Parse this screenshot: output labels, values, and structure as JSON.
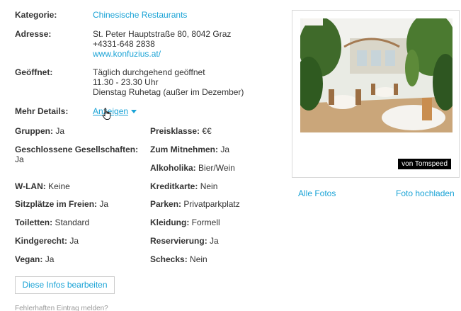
{
  "info": {
    "kategorie": {
      "label": "Kategorie:",
      "value": "Chinesische Restaurants"
    },
    "adresse": {
      "label": "Adresse:",
      "street": "St. Peter Hauptstraße 80, 8042 Graz",
      "phone": "+4331-648 2838",
      "website": "www.konfuzius.at/"
    },
    "geoeffnet": {
      "label": "Geöffnet:",
      "line1": "Täglich durchgehend geöffnet",
      "line2": "11.30 - 23.30 Uhr",
      "line3": "Dienstag Ruhetag (außer im Dezember)"
    },
    "mehr": {
      "label": "Mehr Details:",
      "link": "Anzeigen"
    }
  },
  "features": {
    "gruppen": {
      "label": "Gruppen:",
      "value": "Ja"
    },
    "preisklasse": {
      "label": "Preisklasse:",
      "value": "€€"
    },
    "geschlossene": {
      "label": "Geschlossene Gesellschaften:",
      "value": "Ja"
    },
    "mitnehmen": {
      "label": "Zum Mitnehmen:",
      "value": "Ja"
    },
    "alkoholika": {
      "label": "Alkoholika:",
      "value": "Bier/Wein"
    },
    "wlan": {
      "label": "W-LAN:",
      "value": "Keine"
    },
    "kreditkarte": {
      "label": "Kreditkarte:",
      "value": "Nein"
    },
    "sitzplaetze": {
      "label": "Sitzplätze im Freien:",
      "value": "Ja"
    },
    "parken": {
      "label": "Parken:",
      "value": "Privatparkplatz"
    },
    "toiletten": {
      "label": "Toiletten:",
      "value": "Standard"
    },
    "kleidung": {
      "label": "Kleidung:",
      "value": "Formell"
    },
    "kindgerecht": {
      "label": "Kindgerecht:",
      "value": "Ja"
    },
    "reservierung": {
      "label": "Reservierung:",
      "value": "Ja"
    },
    "vegan": {
      "label": "Vegan:",
      "value": "Ja"
    },
    "schecks": {
      "label": "Schecks:",
      "value": "Nein"
    }
  },
  "actions": {
    "edit_button": "Diese Infos bearbeiten",
    "report_link": "Fehlerhaften Eintrag melden?"
  },
  "photo": {
    "credit": "von Tomspeed",
    "all_photos": "Alle Fotos",
    "upload": "Foto hochladen"
  },
  "colors": {
    "link": "#1aa3d6",
    "text": "#333333"
  }
}
